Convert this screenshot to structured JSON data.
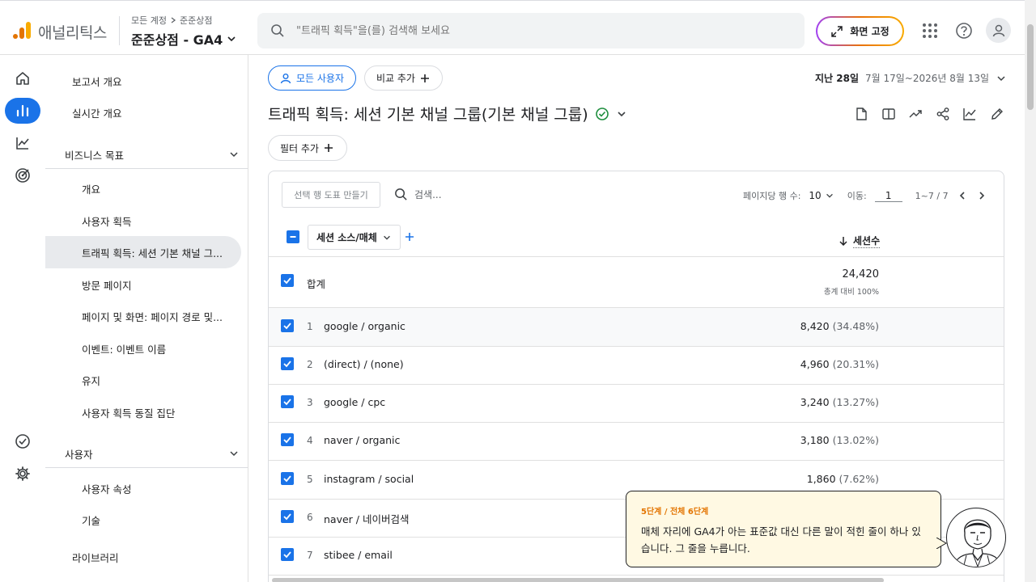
{
  "app": {
    "brand": "애널리틱스",
    "breadcrumb": [
      "모든 계정",
      "준준상점"
    ],
    "property": "준준상점 - GA4",
    "search_placeholder": "\"트래픽 획득\"을(를) 검색해 보세요",
    "pin_label": "화면 고정"
  },
  "nav": {
    "overview": "보고서 개요",
    "realtime": "실시간 개요",
    "section_business": "비즈니스 목표",
    "business_items": [
      "개요",
      "사용자 획득",
      "트래픽 획득: 세션 기본 채널 그...",
      "방문 페이지",
      "페이지 및 화면: 페이지 경로 및...",
      "이벤트: 이벤트 이름",
      "유지",
      "사용자 획득 동질 집단"
    ],
    "section_user": "사용자",
    "user_items": [
      "사용자 속성",
      "기술"
    ],
    "library": "라이브러리"
  },
  "header": {
    "users_chip": "모든 사용자",
    "compare_chip": "비교 추가",
    "date_label": "지난 28일",
    "date_range": "7월 17일~2026년 8월 13일",
    "title": "트래픽 획득: 세션 기본 채널 그룹(기본 채널 그룹)",
    "filter_chip": "필터 추가"
  },
  "table": {
    "make_plot": "선택 행 도표 만들기",
    "search_placeholder": "검색...",
    "rows_per_page_label": "페이지당 행 수:",
    "rows_per_page": "10",
    "goto_label": "이동:",
    "goto_value": "1",
    "range": "1~7 / 7",
    "dimension": "세션 소스/매체",
    "metric": "세션수",
    "total_label": "합계",
    "total_value": "24,420",
    "total_sub": "총계 대비 100%",
    "rows": [
      {
        "rank": "1",
        "dim": "google / organic",
        "value": "8,420",
        "pct": "(34.48%)"
      },
      {
        "rank": "2",
        "dim": "(direct) / (none)",
        "value": "4,960",
        "pct": "(20.31%)"
      },
      {
        "rank": "3",
        "dim": "google / cpc",
        "value": "3,240",
        "pct": "(13.27%)"
      },
      {
        "rank": "4",
        "dim": "naver / organic",
        "value": "3,180",
        "pct": "(13.02%)"
      },
      {
        "rank": "5",
        "dim": "instagram / social",
        "value": "1,860",
        "pct": "(7.62%)"
      },
      {
        "rank": "6",
        "dim": "naver / 네이버검색",
        "value": "",
        "pct": ""
      },
      {
        "rank": "7",
        "dim": "stibee / email",
        "value": "",
        "pct": ""
      }
    ]
  },
  "tooltip": {
    "step": "5단계 / 전체 6단계",
    "text": "매체 자리에 GA4가 아는 표준값 대신 다른 말이 적힌 줄이 하나 있습니다. 그 줄을 누릅니다."
  },
  "colors": {
    "accent": "#1a73e8",
    "tooltip_bg": "#fff9e3",
    "step_color": "#e37400"
  }
}
